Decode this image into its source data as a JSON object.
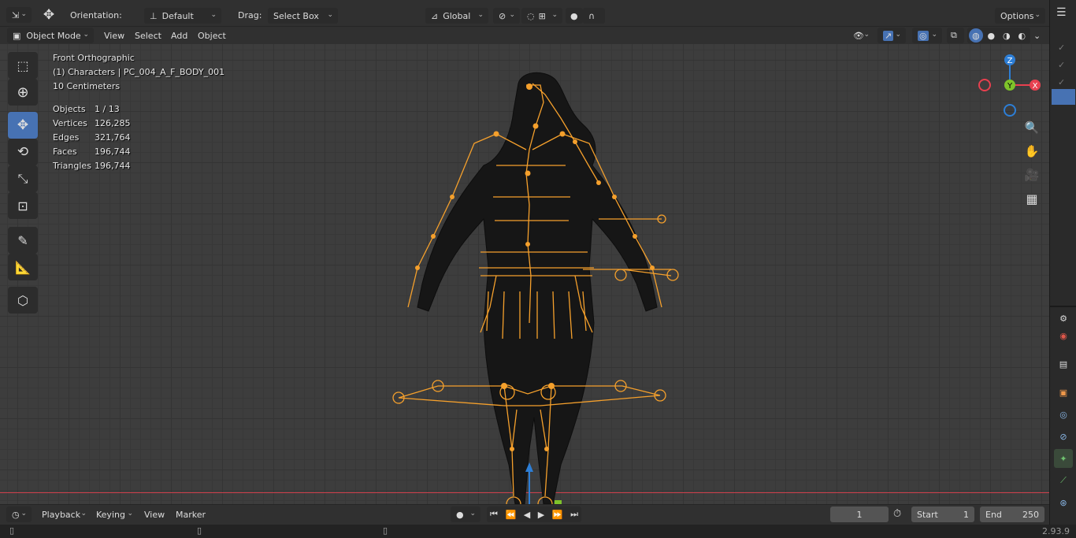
{
  "header": {
    "orientation_label": "Orientation:",
    "orientation_value": "Default",
    "drag_label": "Drag:",
    "drag_value": "Select Box",
    "transform_space": "Global",
    "options_label": "Options"
  },
  "viewport_header": {
    "mode": "Object Mode",
    "menus": [
      "View",
      "Select",
      "Add",
      "Object"
    ]
  },
  "overlay": {
    "view_name": "Front Orthographic",
    "collection_object": "(1) Characters | PC_004_A_F_BODY_001",
    "scale": "10 Centimeters",
    "stats": [
      {
        "label": "Objects",
        "value": "1 / 13"
      },
      {
        "label": "Vertices",
        "value": "126,285"
      },
      {
        "label": "Edges",
        "value": "321,764"
      },
      {
        "label": "Faces",
        "value": "196,744"
      },
      {
        "label": "Triangles",
        "value": "196,744"
      }
    ]
  },
  "gizmo": {
    "z": "Z",
    "y": "Y",
    "x": "X"
  },
  "timeline": {
    "menus": [
      "Playback",
      "Keying",
      "View",
      "Marker"
    ],
    "current_frame": "1",
    "start_label": "Start",
    "start_value": "1",
    "end_label": "End",
    "end_value": "250"
  },
  "status": {
    "version": "2.93.9"
  },
  "colors": {
    "accent": "#4772b3",
    "armature": "#f5a02c",
    "axis_x": "#e8404f",
    "axis_y": "#7ec32a",
    "axis_z": "#2d7ed6"
  }
}
